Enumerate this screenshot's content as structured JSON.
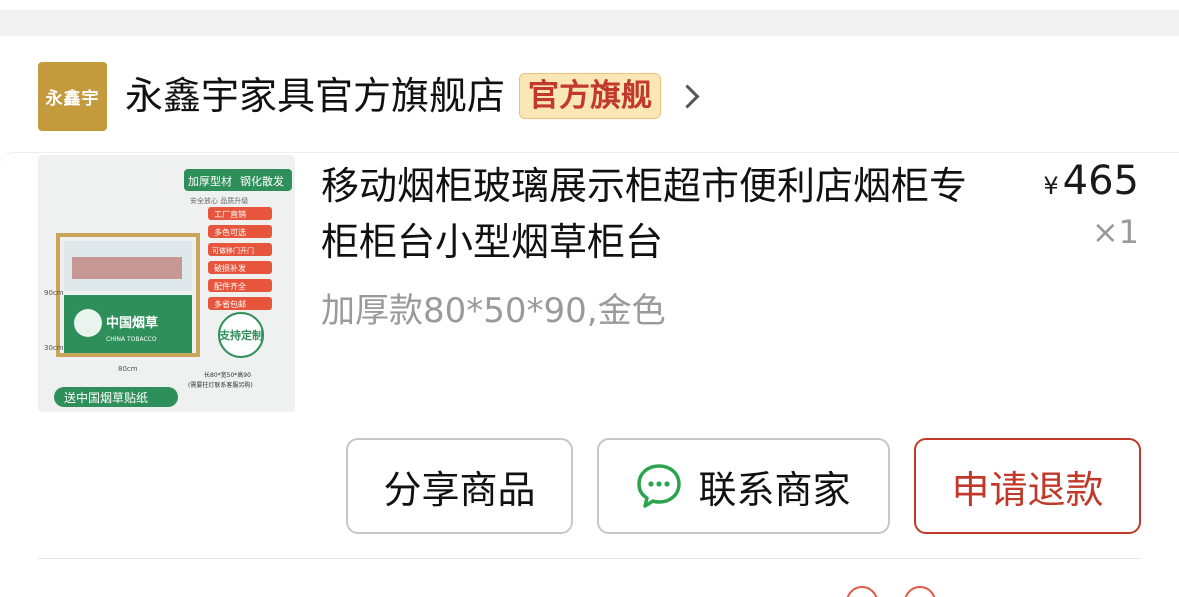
{
  "store": {
    "logo_text": "永鑫宇",
    "name": "永鑫宇家具官方旗舰店",
    "badge": "官方旗舰"
  },
  "product": {
    "title": "移动烟柜玻璃展示柜超市便利店烟柜专柜柜台小型烟草柜台",
    "spec": "加厚款80*50*90,金色",
    "price_symbol": "¥",
    "price": "465",
    "quantity": "×1",
    "image": {
      "tag_top_left": "加厚型材",
      "tag_top_right": "钢化散发",
      "subline": "安全放心  品质升级",
      "features": [
        "工厂直销",
        "多色可选",
        "可做移门开门",
        "破损补发",
        "配件齐全",
        "多省包邮"
      ],
      "brand_panel": "中国烟草",
      "brand_panel_en": "CHINA TOBACCO",
      "custom_badge": "支持定制",
      "dim_height": "90cm",
      "dim_side": "30cm",
      "dim_width": "80cm",
      "size_note": "长80*宽50*高90",
      "size_note_2": "(需要柱灯联系客服另购)",
      "banner": "送中国烟草贴纸"
    }
  },
  "actions": {
    "share": "分享商品",
    "contact": "联系商家",
    "refund": "申请退款"
  },
  "colors": {
    "accent_red": "#c0392b",
    "store_gold": "#c49a3e",
    "badge_bg": "#fbe6b8",
    "wechat_green": "#2aa44f"
  }
}
